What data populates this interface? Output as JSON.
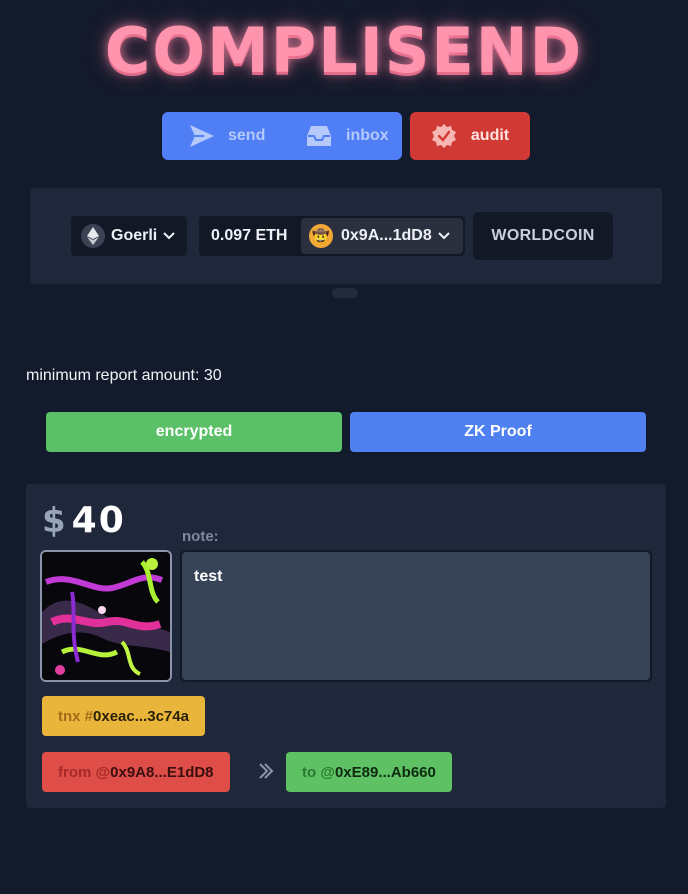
{
  "app": {
    "logo": "COMPLISEND"
  },
  "nav": {
    "send_label": "send",
    "inbox_label": "inbox",
    "audit_label": "audit"
  },
  "wallet": {
    "network": "Goerli",
    "network_icon": "ethereum-icon",
    "balance": "0.097 ETH",
    "address": "0x9A...1dD8",
    "avatar_icon": "cowboy-emoji-avatar",
    "worldcoin_label": "WORLDCOIN"
  },
  "report": {
    "minimum_text": "minimum report amount: 30"
  },
  "modes": {
    "encrypted_label": "encrypted",
    "zk_label": "ZK Proof"
  },
  "card": {
    "currency": "$",
    "amount": "40",
    "note_label": "note:",
    "note_value": "test",
    "tnx_prefix": "tnx #",
    "tnx_value": "0xeac...3c74a",
    "from_prefix": "from @",
    "from_value": "0x9A8...E1dD8",
    "to_prefix": "to @",
    "to_value": "0xE89...Ab660"
  },
  "colors": {
    "background": "#131a2b",
    "logo_pink": "#ff94ae",
    "tab_blue": "#4f7ef5",
    "audit_red": "#d13a34",
    "encrypted_green": "#5cc068",
    "zk_blue": "#4f80f0",
    "tnx_yellow": "#e9b53a",
    "from_red": "#df4d48",
    "to_green": "#5ec264"
  }
}
